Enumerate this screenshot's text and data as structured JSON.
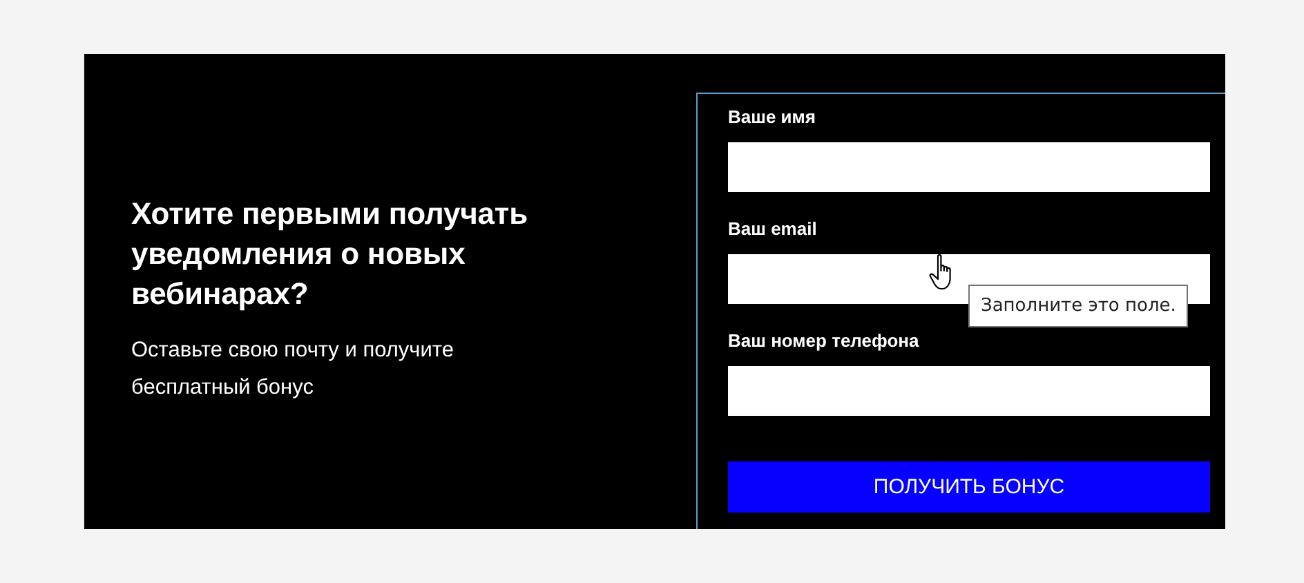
{
  "heading": "Хотите первыми получать уведомления о новых вебинарах?",
  "subtext": "Оставьте свою почту и получите бесплатный бонус",
  "fields": [
    {
      "label": "Ваше имя"
    },
    {
      "label": "Ваш email"
    },
    {
      "label": "Ваш номер телефона"
    }
  ],
  "submit_button": "ПОЛУЧИТЬ БОНУС",
  "tooltip": "Заполните это поле."
}
